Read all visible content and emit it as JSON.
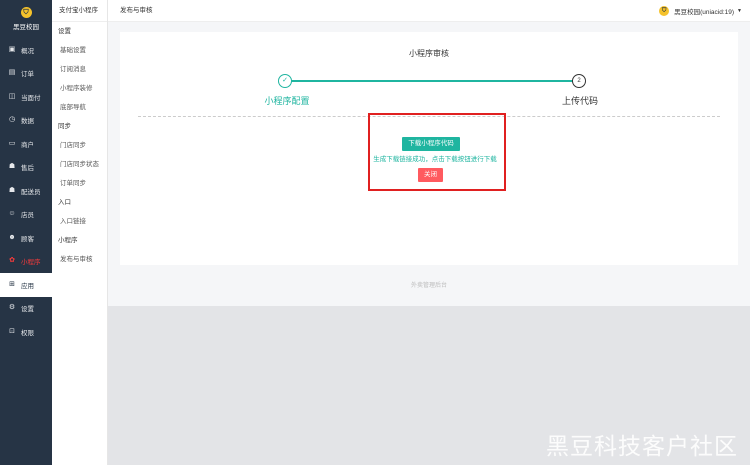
{
  "brand": {
    "name": "黑豆校园",
    "logo_glyph": "⛉"
  },
  "sidebar": {
    "items": [
      {
        "label": "概况",
        "icon": "grid-icon",
        "glyph": "▣"
      },
      {
        "label": "订单",
        "icon": "list-icon",
        "glyph": "▤"
      },
      {
        "label": "当面付",
        "icon": "wallet-icon",
        "glyph": "◫"
      },
      {
        "label": "数据",
        "icon": "chart-icon",
        "glyph": "◷"
      },
      {
        "label": "商户",
        "icon": "store-icon",
        "glyph": "▭"
      },
      {
        "label": "售后",
        "icon": "service-icon",
        "glyph": "☗"
      },
      {
        "label": "配送员",
        "icon": "courier-icon",
        "glyph": "☗"
      },
      {
        "label": "店员",
        "icon": "staff-icon",
        "glyph": "☺"
      },
      {
        "label": "顾客",
        "icon": "customer-icon",
        "glyph": "☻"
      },
      {
        "label": "小程序",
        "icon": "miniapp-icon",
        "glyph": "✿",
        "active": true
      },
      {
        "label": "应用",
        "icon": "apps-icon",
        "glyph": "⊞",
        "selected": true
      },
      {
        "label": "设置",
        "icon": "gear-icon",
        "glyph": "⚙"
      },
      {
        "label": "权限",
        "icon": "lock-icon",
        "glyph": "⊡"
      }
    ]
  },
  "subnav": {
    "title": "支付宝小程序",
    "groups": [
      {
        "label": "设置",
        "items": [
          "基础设置",
          "订阅消息",
          "小程序装修",
          "底部导航"
        ]
      },
      {
        "label": "同步",
        "items": [
          "门店同步",
          "门店同步状态",
          "订单同步"
        ]
      },
      {
        "label": "入口",
        "items": [
          "入口链接"
        ]
      },
      {
        "label": "小程序",
        "items": [
          "发布与审核"
        ]
      }
    ]
  },
  "topbar": {
    "breadcrumb": "发布与审核",
    "user": "黑豆校园(uniacid:19)",
    "caret": "▼"
  },
  "review": {
    "title": "小程序审核",
    "step1": {
      "label": "小程序配置",
      "mark": "✓"
    },
    "step2": {
      "label": "上传代码",
      "mark": "2"
    },
    "download_button": "下载小程序代码",
    "message": "生成下载链接成功，点击下载按钮进行下载",
    "close_button": "关闭"
  },
  "footer": {
    "text": "外卖管理后台"
  },
  "watermark": "黑豆科技客户社区",
  "colors": {
    "accent": "#1fb5a0",
    "sidebar": "#263445",
    "danger": "#ff5a5f",
    "highlight": "#e02020"
  }
}
